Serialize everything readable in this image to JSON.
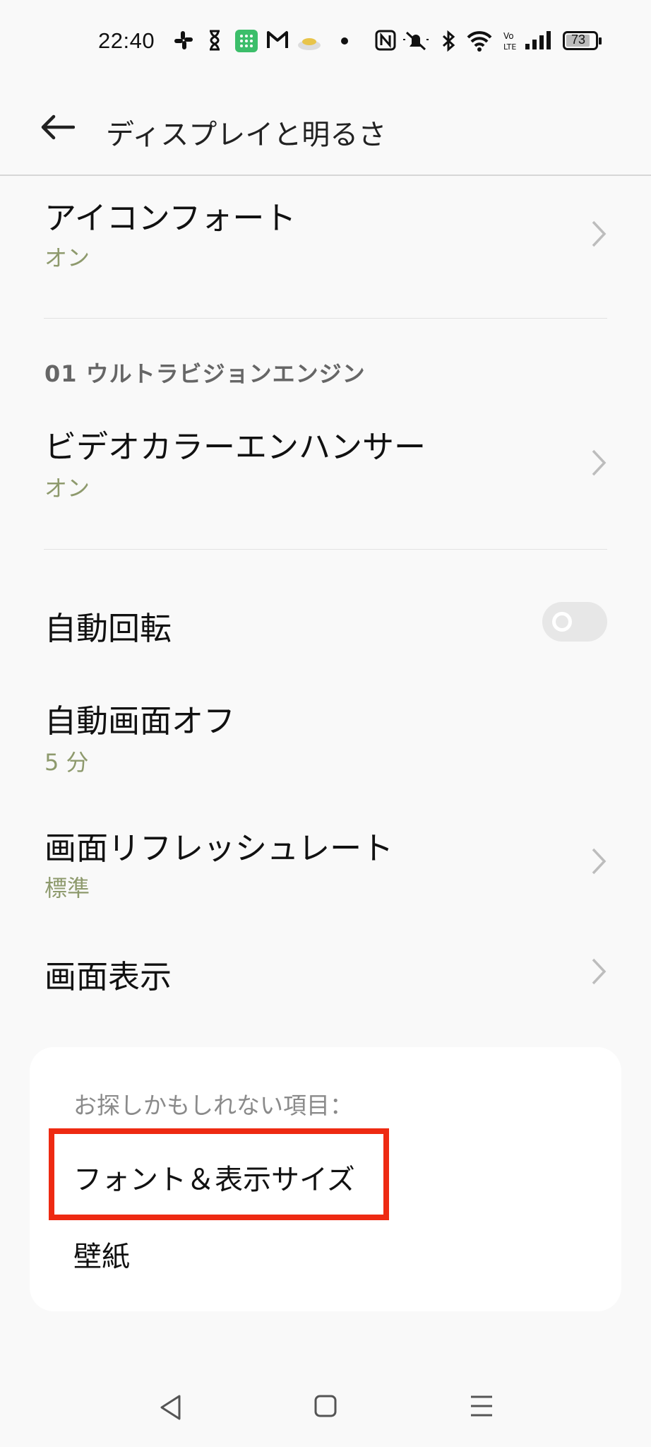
{
  "status_bar": {
    "time": "22:40",
    "battery": "73",
    "icons": [
      "slack-icon",
      "hourglass-icon",
      "grid-app-icon",
      "gmail-icon",
      "app-icon",
      "dot-icon",
      "nfc-icon",
      "mute-icon",
      "bluetooth-icon",
      "wifi-icon",
      "volte-icon",
      "signal-icon",
      "battery-icon"
    ]
  },
  "header": {
    "title": "ディスプレイと明るさ",
    "back_icon": "back-arrow-icon"
  },
  "settings": {
    "icon_font": {
      "title": "アイコンフォート",
      "value": "オン"
    },
    "section_label": "01 ウルトラビジョンエンジン",
    "video_color": {
      "title": "ビデオカラーエンハンサー",
      "value": "オン"
    },
    "auto_rotate": {
      "title": "自動回転",
      "enabled": false
    },
    "auto_screen_off": {
      "title": "自動画面オフ",
      "value": "5 分"
    },
    "refresh_rate": {
      "title": "画面リフレッシュレート",
      "value": "標準"
    },
    "screen_display": {
      "title": "画面表示"
    }
  },
  "suggestions": {
    "heading": "お探しかもしれない項目：",
    "items": [
      "フォント＆表示サイズ",
      "壁紙"
    ]
  },
  "colors": {
    "accent_subtext": "#8e9a6d",
    "highlight": "#ee2a12",
    "background": "#f9f9f9"
  },
  "nav_bar": {
    "icons": [
      "back-triangle-icon",
      "home-square-icon",
      "menu-icon"
    ]
  }
}
